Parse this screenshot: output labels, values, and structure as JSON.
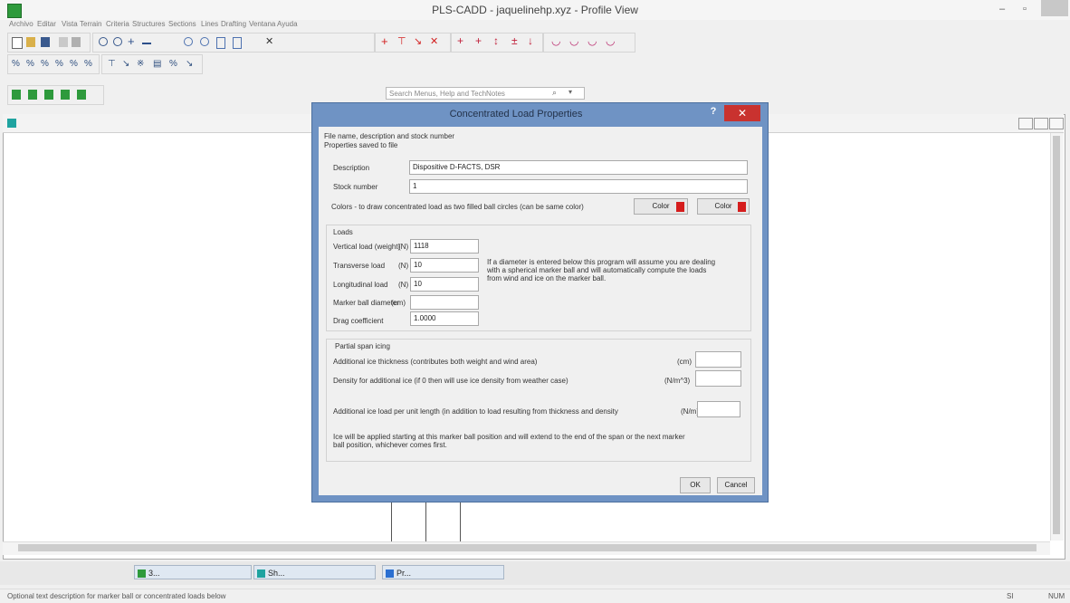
{
  "window": {
    "title": "PLS-CADD - jaquelinehp.xyz - Profile View"
  },
  "menu": [
    "Archivo",
    "Editar",
    "Vista",
    "Terrain",
    "Criteria",
    "Structures",
    "Sections",
    "Lines",
    "Drafting",
    "Ventana",
    "Ayuda"
  ],
  "search": {
    "placeholder": "Search Menus, Help and TechNotes"
  },
  "dialog": {
    "title": "Concentrated Load Properties",
    "help": "?",
    "close": "✕",
    "file_section": "File name, description and stock number",
    "saved_label": "Properties saved to file",
    "description_label": "Description",
    "description_value": "Dispositive D-FACTS, DSR",
    "stock_label": "Stock number",
    "stock_value": "1",
    "colors_label": "Colors - to draw concentrated load as two filled ball circles (can be same color)",
    "color_btn_1": "Color",
    "color_btn_2": "Color",
    "color_value": "#d51d1d",
    "loads_title": "Loads",
    "vertical_label": "Vertical load (weight)",
    "vertical_unit": "(N)",
    "vertical_value": "1118",
    "transverse_label": "Transverse load",
    "transverse_unit": "(N)",
    "transverse_value": "10",
    "longitudinal_label": "Longitudinal load",
    "longitudinal_unit": "(N)",
    "longitudinal_value": "10",
    "marker_label": "Marker ball diameter",
    "marker_unit": "(cm)",
    "marker_value": "",
    "drag_label": "Drag coefficient",
    "drag_value": "1.0000",
    "diameter_note_1": "If a diameter is entered below this program will assume you are dealing",
    "diameter_note_2": "with a spherical marker ball and will automatically compute the loads",
    "diameter_note_3": "from wind and ice on the marker ball.",
    "partial_title": "Partial span icing",
    "ice_thickness_label": "Additional ice thickness (contributes both weight and wind area)",
    "ice_thickness_unit": "(cm)",
    "ice_density_label": "Density for additional ice (if 0 then will use ice density from weather case)",
    "ice_density_unit": "(N/m^3)",
    "ice_load_label": "Additional ice load per unit length (in addition to load resulting from thickness and density",
    "ice_load_unit": "(N/m)",
    "ice_note_1": "Ice will be applied starting at this marker ball position and will extend to the end of the span or the next marker",
    "ice_note_2": "ball position, whichever comes first.",
    "ok": "OK",
    "cancel": "Cancel"
  },
  "taskbar": [
    {
      "label": "3...",
      "icon_color": "#2e9a3c"
    },
    {
      "label": "Sh...",
      "icon_color": "#1fa3a0"
    },
    {
      "label": "Pr...",
      "icon_color": "#2a6fd1"
    }
  ],
  "status": {
    "left": "Optional text description for marker ball or concentrated loads below",
    "mid": "SI",
    "right": "NUM"
  }
}
